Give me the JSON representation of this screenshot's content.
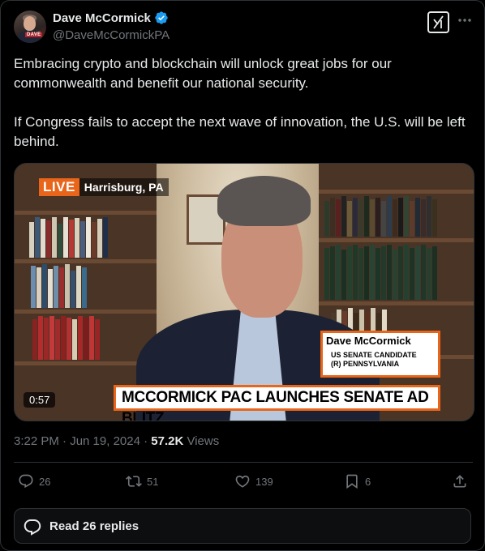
{
  "author": {
    "name": "Dave McCormick",
    "handle": "@DaveMcCormickPA",
    "avatar_badge_text": "DAVE",
    "verified_color": "#1d9bf0"
  },
  "tweet": {
    "paragraphs": [
      "Embracing crypto and blockchain will unlock great jobs for our commonwealth and benefit our national security.",
      "If Congress fails to accept the next wave of innovation, the U.S. will be left behind."
    ]
  },
  "video": {
    "live_label": "LIVE",
    "location": "Harrisburg, PA",
    "lower_third_name": "Dave McCormick",
    "lower_third_role_line1": "US SENATE CANDIDATE",
    "lower_third_role_line2": "(R) PENNSYLVANIA",
    "headline": "MCCORMICK PAC LAUNCHES SENATE AD BLITZ",
    "duration": "0:57",
    "accent_color": "#e8651a"
  },
  "meta": {
    "timestamp": "3:22 PM · Jun 19, 2024",
    "separator": " · ",
    "views_count": "57.2K",
    "views_label": "Views"
  },
  "actions": {
    "replies": "26",
    "reposts": "51",
    "likes": "139",
    "bookmarks": "6"
  },
  "replies_button": {
    "label": "Read 26 replies"
  },
  "icons": {
    "verified": "verified-badge-icon",
    "grok": "grok-icon",
    "more": "more-horizontal-icon",
    "reply": "reply-icon",
    "repost": "repost-icon",
    "like": "heart-icon",
    "bookmark": "bookmark-icon",
    "share": "share-icon",
    "replies_button": "chat-bubble-icon"
  }
}
